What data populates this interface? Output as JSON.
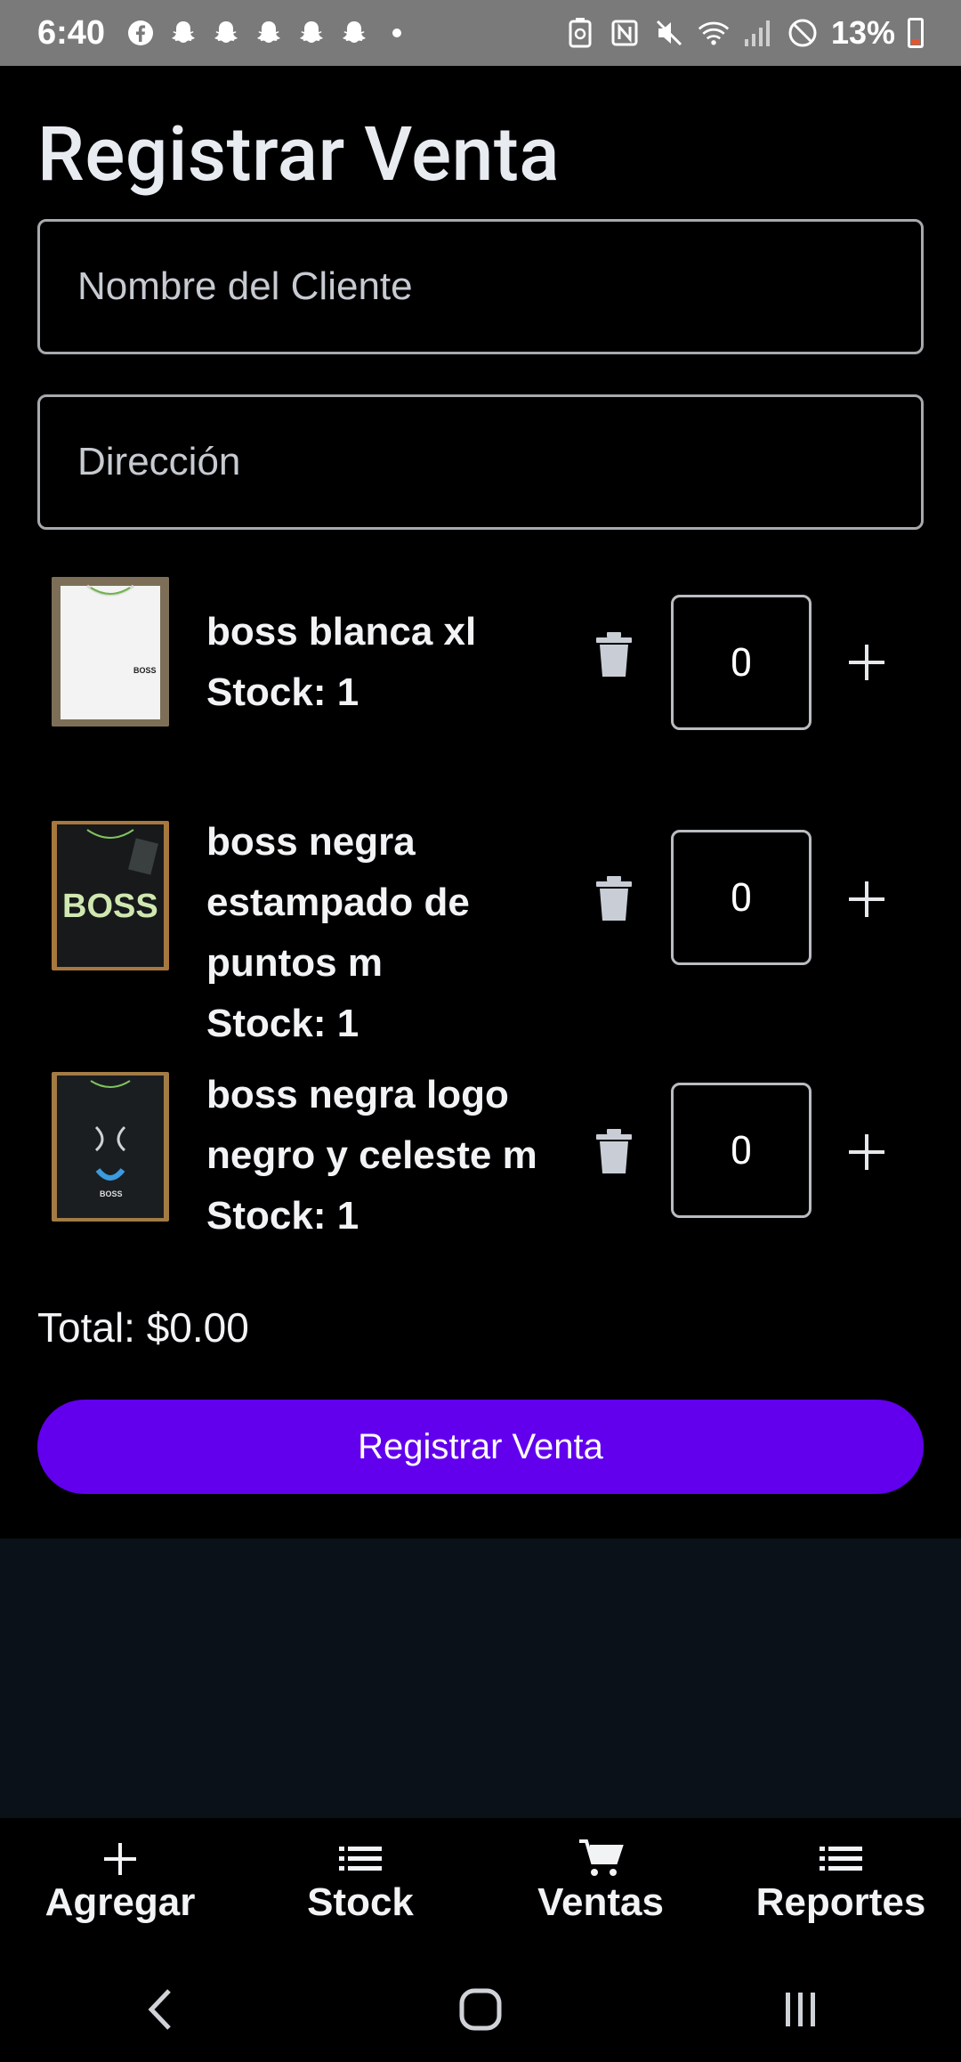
{
  "status_bar": {
    "time": "6:40",
    "battery": "13%"
  },
  "page": {
    "title": "Registrar Venta"
  },
  "form": {
    "client_placeholder": "Nombre del Cliente",
    "address_placeholder": "Dirección"
  },
  "products": [
    {
      "name_line1": "boss blanca xl",
      "name_line2": "",
      "name_line3": "",
      "stock": "Stock: 1",
      "qty": "0",
      "thumb": "white-shirt"
    },
    {
      "name_line1": "boss negra",
      "name_line2": "estampado de",
      "name_line3": "puntos m",
      "stock": "Stock: 1",
      "qty": "0",
      "thumb": "black-boss-shirt"
    },
    {
      "name_line1": "boss negra logo",
      "name_line2": "negro y celeste m",
      "name_line3": "",
      "stock": "Stock: 1",
      "qty": "0",
      "thumb": "black-logo-shirt"
    }
  ],
  "summary": {
    "total": "Total: $0.00",
    "register_button": "Registrar Venta"
  },
  "bottom_nav": [
    {
      "label": "Agregar",
      "icon": "plus-icon"
    },
    {
      "label": "Stock",
      "icon": "list-icon"
    },
    {
      "label": "Ventas",
      "icon": "cart-icon"
    },
    {
      "label": "Reportes",
      "icon": "list-icon"
    }
  ],
  "colors": {
    "accent": "#6200ee",
    "background": "#000000",
    "status_bar": "#7a7a7a"
  },
  "thumb_text": {
    "shirt_brand": "BOSS"
  }
}
